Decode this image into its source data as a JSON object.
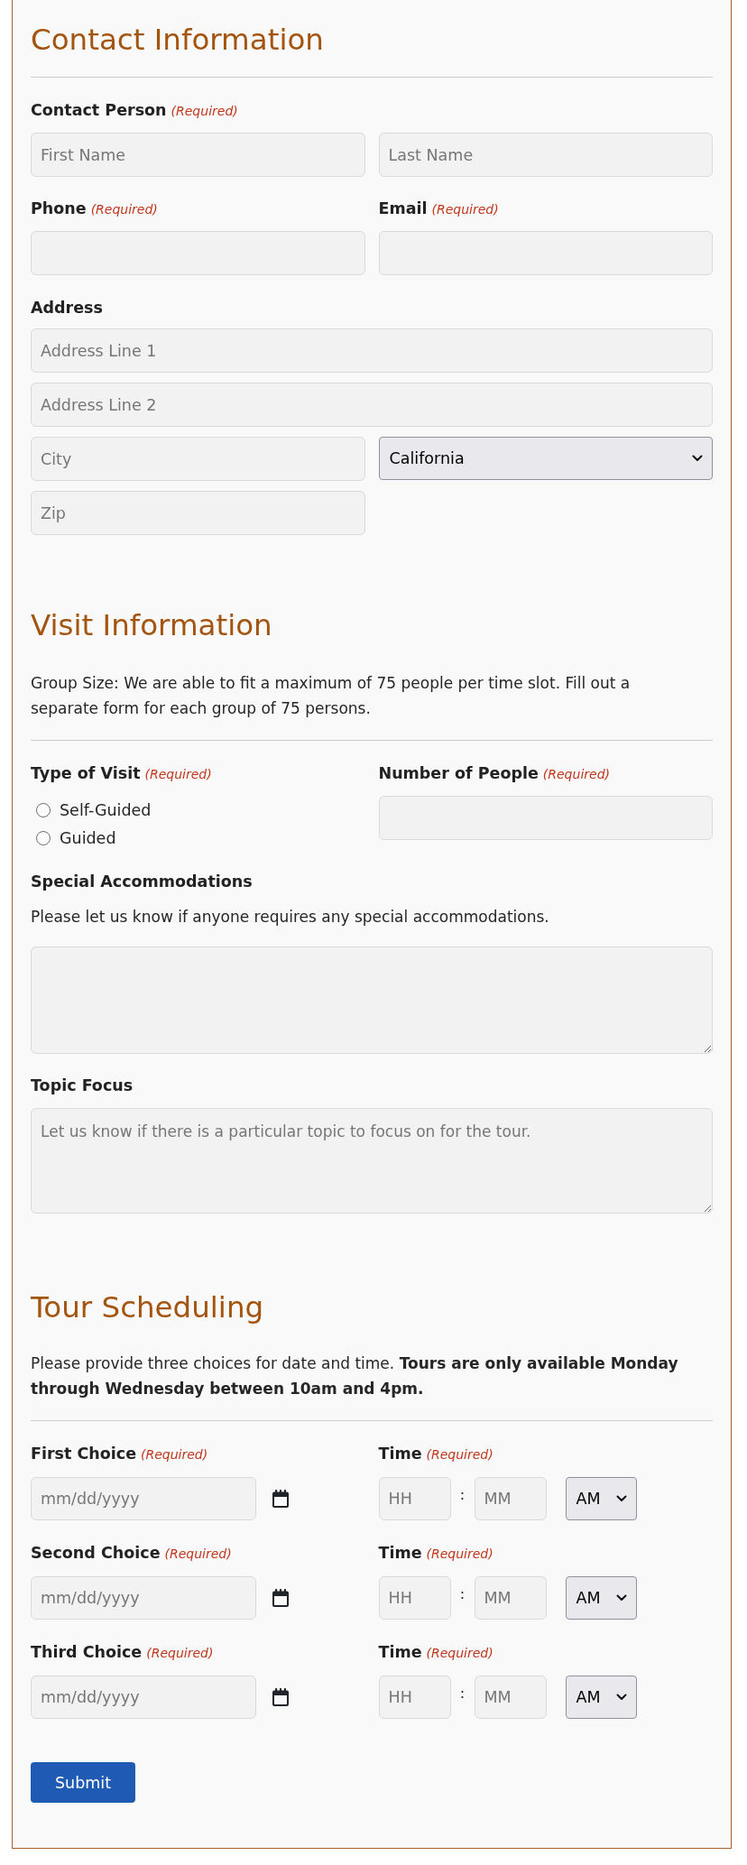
{
  "contact": {
    "title": "Contact Information",
    "contact_person": {
      "label": "Contact Person",
      "required": "(Required)",
      "first_name": {
        "placeholder": "First Name"
      },
      "last_name": {
        "placeholder": "Last Name"
      }
    },
    "phone": {
      "label": "Phone",
      "required": "(Required)"
    },
    "email": {
      "label": "Email",
      "required": "(Required)"
    },
    "address": {
      "label": "Address",
      "line_1": {
        "placeholder": "Address Line 1"
      },
      "line_2": {
        "placeholder": "Address Line 2"
      },
      "city": {
        "placeholder": "City"
      },
      "state": {
        "value": "California"
      },
      "zip": {
        "placeholder": "Zip"
      }
    }
  },
  "visit": {
    "title": "Visit Information",
    "note": "Group Size: We are able to fit a maximum of 75 people per time slot. Fill out a separate form for each group of 75 persons.",
    "type_of_visit": {
      "label": "Type of Visit",
      "required": "(Required)",
      "options": [
        {
          "label": "Self-Guided",
          "selected": false
        },
        {
          "label": "Guided",
          "selected": false
        }
      ]
    },
    "number_of_people": {
      "label": "Number of People",
      "required": "(Required)"
    },
    "special_accommodations": {
      "label": "Special Accommodations",
      "help": "Please let us know if anyone requires any special accommodations."
    },
    "topic_focus": {
      "label": "Topic Focus",
      "placeholder": "Let us know if there is a particular topic to focus on for the tour."
    }
  },
  "scheduling": {
    "title": "Tour Scheduling",
    "note": "Please provide three choices for date and time. **Tours are only available Monday through Wednesday between 10am and 4pm.**",
    "choices": [
      {
        "label": "First Choice",
        "required": "(Required)",
        "date_placeholder": "mm/dd/yyyy",
        "time_label": "Time",
        "time_required": "(Required)",
        "hour_placeholder": "HH",
        "separator": ":",
        "minute_placeholder": "MM",
        "period": "AM"
      },
      {
        "label": "Second Choice",
        "required": "(Required)",
        "date_placeholder": "mm/dd/yyyy",
        "time_label": "Time",
        "time_required": "(Required)",
        "hour_placeholder": "HH",
        "separator": ":",
        "minute_placeholder": "MM",
        "period": "AM"
      },
      {
        "label": "Third Choice",
        "required": "(Required)",
        "date_placeholder": "mm/dd/yyyy",
        "time_label": "Time",
        "time_required": "(Required)",
        "hour_placeholder": "HH",
        "separator": ":",
        "minute_placeholder": "MM",
        "period": "AM"
      }
    ]
  },
  "submit": {
    "label": "Submit"
  }
}
